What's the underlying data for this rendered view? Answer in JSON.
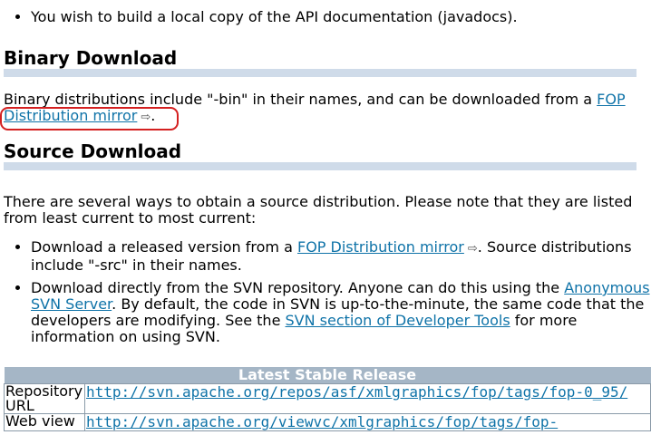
{
  "top_list": {
    "item1": "You wish to build a local copy of the API documentation (javadocs)."
  },
  "binary": {
    "heading": "Binary Download",
    "text_before": "Binary distributions include \"-bin\" in their names, and can be downloaded from a ",
    "link": "FOP Distribution mirror",
    "text_after": "."
  },
  "source": {
    "heading": "Source Download",
    "intro": "There are several ways to obtain a source distribution. Please note that they are listed from least current to most current:",
    "item1": {
      "text_before": "Download a released version from a ",
      "link": "FOP Distribution mirror",
      "text_after": ". Source distributions include \"-src\" in their names."
    },
    "item2": {
      "text_before": "Download directly from the SVN repository. Anyone can do this using the ",
      "link1": "Anonymous SVN Server",
      "text_middle": ". By default, the code in SVN is up-to-the-minute, the same code that the developers are modifying. See the ",
      "link2": "SVN section of Developer Tools",
      "text_after": " for more information on using SVN."
    }
  },
  "table": {
    "header": "Latest Stable Release",
    "rows": [
      {
        "label": "Repository URL",
        "value": "http://svn.apache.org/repos/asf/xmlgraphics/fop/tags/fop-0_95/"
      },
      {
        "label": "Web view",
        "value": "http://svn.apache.org/viewvc/xmlgraphics/fop/tags/fop-"
      }
    ]
  },
  "icons": {
    "external_link": "external-link-icon"
  },
  "colors": {
    "link": "#0f73a8",
    "heading_bar": "#cfdbe9",
    "table_header": "#a5b6c6",
    "highlight": "#d42020"
  }
}
